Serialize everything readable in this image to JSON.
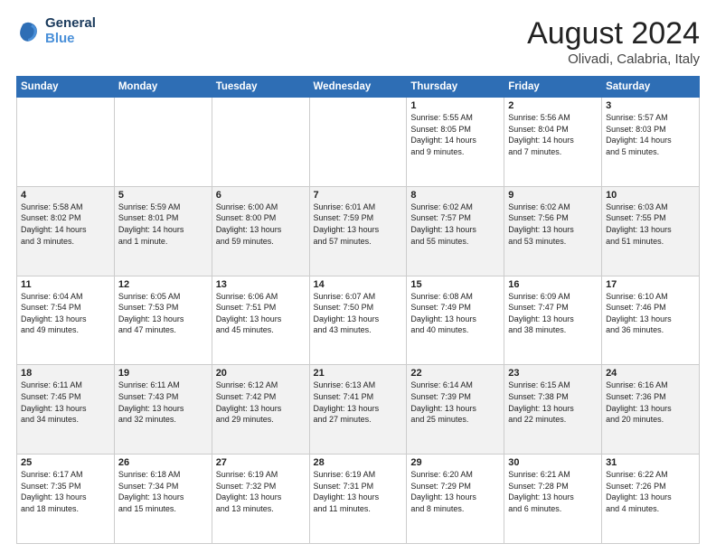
{
  "header": {
    "logo_line1": "General",
    "logo_line2": "Blue",
    "title": "August 2024",
    "subtitle": "Olivadi, Calabria, Italy"
  },
  "days_of_week": [
    "Sunday",
    "Monday",
    "Tuesday",
    "Wednesday",
    "Thursday",
    "Friday",
    "Saturday"
  ],
  "weeks": [
    [
      {
        "day": "",
        "info": ""
      },
      {
        "day": "",
        "info": ""
      },
      {
        "day": "",
        "info": ""
      },
      {
        "day": "",
        "info": ""
      },
      {
        "day": "1",
        "info": "Sunrise: 5:55 AM\nSunset: 8:05 PM\nDaylight: 14 hours\nand 9 minutes."
      },
      {
        "day": "2",
        "info": "Sunrise: 5:56 AM\nSunset: 8:04 PM\nDaylight: 14 hours\nand 7 minutes."
      },
      {
        "day": "3",
        "info": "Sunrise: 5:57 AM\nSunset: 8:03 PM\nDaylight: 14 hours\nand 5 minutes."
      }
    ],
    [
      {
        "day": "4",
        "info": "Sunrise: 5:58 AM\nSunset: 8:02 PM\nDaylight: 14 hours\nand 3 minutes."
      },
      {
        "day": "5",
        "info": "Sunrise: 5:59 AM\nSunset: 8:01 PM\nDaylight: 14 hours\nand 1 minute."
      },
      {
        "day": "6",
        "info": "Sunrise: 6:00 AM\nSunset: 8:00 PM\nDaylight: 13 hours\nand 59 minutes."
      },
      {
        "day": "7",
        "info": "Sunrise: 6:01 AM\nSunset: 7:59 PM\nDaylight: 13 hours\nand 57 minutes."
      },
      {
        "day": "8",
        "info": "Sunrise: 6:02 AM\nSunset: 7:57 PM\nDaylight: 13 hours\nand 55 minutes."
      },
      {
        "day": "9",
        "info": "Sunrise: 6:02 AM\nSunset: 7:56 PM\nDaylight: 13 hours\nand 53 minutes."
      },
      {
        "day": "10",
        "info": "Sunrise: 6:03 AM\nSunset: 7:55 PM\nDaylight: 13 hours\nand 51 minutes."
      }
    ],
    [
      {
        "day": "11",
        "info": "Sunrise: 6:04 AM\nSunset: 7:54 PM\nDaylight: 13 hours\nand 49 minutes."
      },
      {
        "day": "12",
        "info": "Sunrise: 6:05 AM\nSunset: 7:53 PM\nDaylight: 13 hours\nand 47 minutes."
      },
      {
        "day": "13",
        "info": "Sunrise: 6:06 AM\nSunset: 7:51 PM\nDaylight: 13 hours\nand 45 minutes."
      },
      {
        "day": "14",
        "info": "Sunrise: 6:07 AM\nSunset: 7:50 PM\nDaylight: 13 hours\nand 43 minutes."
      },
      {
        "day": "15",
        "info": "Sunrise: 6:08 AM\nSunset: 7:49 PM\nDaylight: 13 hours\nand 40 minutes."
      },
      {
        "day": "16",
        "info": "Sunrise: 6:09 AM\nSunset: 7:47 PM\nDaylight: 13 hours\nand 38 minutes."
      },
      {
        "day": "17",
        "info": "Sunrise: 6:10 AM\nSunset: 7:46 PM\nDaylight: 13 hours\nand 36 minutes."
      }
    ],
    [
      {
        "day": "18",
        "info": "Sunrise: 6:11 AM\nSunset: 7:45 PM\nDaylight: 13 hours\nand 34 minutes."
      },
      {
        "day": "19",
        "info": "Sunrise: 6:11 AM\nSunset: 7:43 PM\nDaylight: 13 hours\nand 32 minutes."
      },
      {
        "day": "20",
        "info": "Sunrise: 6:12 AM\nSunset: 7:42 PM\nDaylight: 13 hours\nand 29 minutes."
      },
      {
        "day": "21",
        "info": "Sunrise: 6:13 AM\nSunset: 7:41 PM\nDaylight: 13 hours\nand 27 minutes."
      },
      {
        "day": "22",
        "info": "Sunrise: 6:14 AM\nSunset: 7:39 PM\nDaylight: 13 hours\nand 25 minutes."
      },
      {
        "day": "23",
        "info": "Sunrise: 6:15 AM\nSunset: 7:38 PM\nDaylight: 13 hours\nand 22 minutes."
      },
      {
        "day": "24",
        "info": "Sunrise: 6:16 AM\nSunset: 7:36 PM\nDaylight: 13 hours\nand 20 minutes."
      }
    ],
    [
      {
        "day": "25",
        "info": "Sunrise: 6:17 AM\nSunset: 7:35 PM\nDaylight: 13 hours\nand 18 minutes."
      },
      {
        "day": "26",
        "info": "Sunrise: 6:18 AM\nSunset: 7:34 PM\nDaylight: 13 hours\nand 15 minutes."
      },
      {
        "day": "27",
        "info": "Sunrise: 6:19 AM\nSunset: 7:32 PM\nDaylight: 13 hours\nand 13 minutes."
      },
      {
        "day": "28",
        "info": "Sunrise: 6:19 AM\nSunset: 7:31 PM\nDaylight: 13 hours\nand 11 minutes."
      },
      {
        "day": "29",
        "info": "Sunrise: 6:20 AM\nSunset: 7:29 PM\nDaylight: 13 hours\nand 8 minutes."
      },
      {
        "day": "30",
        "info": "Sunrise: 6:21 AM\nSunset: 7:28 PM\nDaylight: 13 hours\nand 6 minutes."
      },
      {
        "day": "31",
        "info": "Sunrise: 6:22 AM\nSunset: 7:26 PM\nDaylight: 13 hours\nand 4 minutes."
      }
    ]
  ]
}
